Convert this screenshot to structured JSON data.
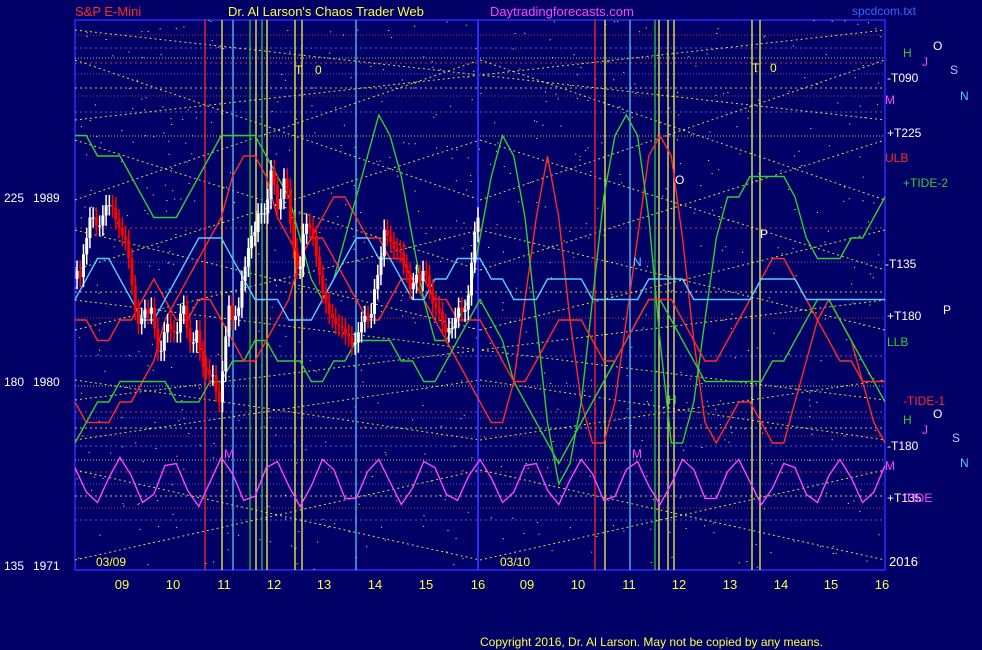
{
  "header": {
    "instrument": "S&P E-Mini",
    "site": "Dr. Al Larson's Chaos Trader Web",
    "url": "Daytradingforecasts.com",
    "file": "spcdcom.txt"
  },
  "footer": {
    "copyright": "Copyright 2016, Dr. Al Larson. May not be copied by any means."
  },
  "colors": {
    "background": "#000066",
    "price_up": "#ffffff",
    "price_down": "#ff0000",
    "cyan": "#55ccff",
    "green": "#33cc33",
    "red": "#ff2a2a",
    "yellow": "#ffff44",
    "magenta": "#ff44ff",
    "grid_blue": "#3333ff"
  },
  "chart_data": {
    "type": "line",
    "title": "S&P E-Mini",
    "x_tick_labels": [
      "09",
      "10",
      "11",
      "12",
      "13",
      "14",
      "15",
      "16",
      "09",
      "10",
      "11",
      "12",
      "13",
      "14",
      "15",
      "16"
    ],
    "date_labels": [
      "03/09",
      "03/10"
    ],
    "year_label": "2016",
    "y_ticks": [
      {
        "angle": "225",
        "price": "1989"
      },
      {
        "angle": "180",
        "price": "1980"
      },
      {
        "angle": "135",
        "price": "1971"
      }
    ],
    "ylim": [
      1971,
      1989
    ],
    "right_labels": [
      {
        "text": "H",
        "color": "#33cc33"
      },
      {
        "text": "J",
        "color": "#ff44ff"
      },
      {
        "text": "O",
        "color": "#ffffff"
      },
      {
        "text": "S",
        "color": "#aaccff"
      },
      {
        "text": "N",
        "color": "#55ccff"
      },
      {
        "text": "-T090",
        "color": "#ffffff"
      },
      {
        "text": "M",
        "color": "#ff44ff"
      },
      {
        "text": "+T225",
        "color": "#ffffff"
      },
      {
        "text": "ULB",
        "color": "#ff2a2a"
      },
      {
        "text": "+TIDE-2",
        "color": "#33cc33"
      },
      {
        "text": "-T135",
        "color": "#ffffff"
      },
      {
        "text": "+T180",
        "color": "#ffffff"
      },
      {
        "text": "P",
        "color": "#ffffff"
      },
      {
        "text": "LLB",
        "color": "#33cc33"
      },
      {
        "text": "-TIDE-1",
        "color": "#ff2a2a"
      },
      {
        "text": "H",
        "color": "#33cc33"
      },
      {
        "text": "J",
        "color": "#ff44ff"
      },
      {
        "text": "O",
        "color": "#ffffff"
      },
      {
        "text": "S",
        "color": "#aaccff"
      },
      {
        "text": "N",
        "color": "#55ccff"
      },
      {
        "text": "-T180",
        "color": "#ffffff"
      },
      {
        "text": "M",
        "color": "#ff44ff"
      },
      {
        "text": "+T135",
        "color": "#ffffff"
      },
      {
        "text": "TIDE",
        "color": "#ff44ff"
      }
    ],
    "plot_letters": [
      {
        "text": "T",
        "color": "#ffff44"
      },
      {
        "text": "0",
        "color": "#ffff44"
      },
      {
        "text": "T",
        "color": "#ffff44"
      },
      {
        "text": "0",
        "color": "#ffff44"
      },
      {
        "text": "O",
        "color": "#ffffff"
      },
      {
        "text": "P",
        "color": "#ffffff"
      },
      {
        "text": "N",
        "color": "#55ccff"
      },
      {
        "text": "M",
        "color": "#ff44ff"
      },
      {
        "text": "M",
        "color": "#ff44ff"
      },
      {
        "text": "H",
        "color": "#33cc33"
      }
    ],
    "series": [
      {
        "label_text": "ULB",
        "color": "#ff2a2a",
        "values": [
          1979,
          1978,
          1978,
          1978,
          1979,
          1979,
          1980,
          1981,
          1983,
          1984,
          1985,
          1986,
          1987,
          1988,
          1990,
          1991,
          1991,
          1990,
          1988,
          1987,
          1986,
          1987,
          1988,
          1989,
          1989,
          1988,
          1987,
          1987,
          1986,
          1986,
          1985,
          1984,
          1983,
          1982,
          1981,
          1980,
          1979,
          1978,
          1978,
          1980,
          1984,
          1988,
          1991,
          1988,
          1983,
          1979,
          1977,
          1977,
          1979,
          1983,
          1987,
          1991,
          1992,
          1991,
          1987,
          1982,
          1978,
          1977,
          1978,
          1979,
          1979,
          1978,
          1977,
          1977,
          1979,
          1981,
          1983,
          1984,
          1983,
          1982,
          1980,
          1978,
          1977
        ]
      },
      {
        "label_text": "+TIDE-2",
        "color": "#33cc33",
        "values": [
          1992,
          1992,
          1991,
          1991,
          1991,
          1990,
          1989,
          1988,
          1988,
          1988,
          1989,
          1990,
          1991,
          1992,
          1992,
          1992,
          1992,
          1991,
          1990,
          1989,
          1987,
          1985,
          1984,
          1985,
          1987,
          1989,
          1991,
          1993,
          1992,
          1990,
          1987,
          1984,
          1982,
          1982,
          1983,
          1984,
          1987,
          1990,
          1992,
          1991,
          1988,
          1983,
          1978,
          1975,
          1976,
          1979,
          1984,
          1989,
          1992,
          1993,
          1992,
          1988,
          1982,
          1977,
          1977,
          1979,
          1983,
          1987,
          1989,
          1989,
          1990,
          1990,
          1990,
          1990,
          1989,
          1987,
          1986,
          1986,
          1986,
          1987,
          1987,
          1988,
          1989
        ]
      },
      {
        "label_text": "LLB",
        "color": "#33cc33",
        "values": [
          1977,
          1978,
          1979,
          1979,
          1980,
          1980,
          1980,
          1980,
          1980,
          1979,
          1979,
          1979,
          1980,
          1980,
          1981,
          1981,
          1982,
          1982,
          1981,
          1981,
          1981,
          1980,
          1980,
          1981,
          1981,
          1982,
          1982,
          1982,
          1982,
          1981,
          1981,
          1980,
          1980,
          1981,
          1982,
          1983,
          1984,
          1983,
          1982,
          1980,
          1979,
          1978,
          1977,
          1976,
          1977,
          1978,
          1979,
          1980,
          1981,
          1982,
          1983,
          1984,
          1984,
          1983,
          1982,
          1981,
          1980,
          1980,
          1980,
          1980,
          1980,
          1980,
          1981,
          1981,
          1982,
          1983,
          1984,
          1984,
          1983,
          1982,
          1981,
          1980,
          1979
        ]
      },
      {
        "label_text": "-TIDE-1",
        "color": "#ff2a2a",
        "values": [
          1983,
          1983,
          1982,
          1982,
          1983,
          1983,
          1984,
          1985,
          1984,
          1983,
          1983,
          1984,
          1984,
          1983,
          1982,
          1981,
          1981,
          1982,
          1983,
          1984,
          1986,
          1987,
          1987,
          1986,
          1985,
          1984,
          1983,
          1983,
          1984,
          1985,
          1985,
          1985,
          1984,
          1984,
          1983,
          1983,
          1983,
          1982,
          1981,
          1980,
          1980,
          1981,
          1982,
          1983,
          1983,
          1983,
          1982,
          1981,
          1981,
          1982,
          1983,
          1984,
          1984,
          1984,
          1983,
          1982,
          1981,
          1981,
          1982,
          1983,
          1984,
          1985,
          1986,
          1986,
          1985,
          1984,
          1983,
          1982,
          1981,
          1981,
          1980,
          1980,
          1980
        ]
      },
      {
        "label_text": "N",
        "color": "#55ccff",
        "values": [
          1984,
          1985,
          1986,
          1986,
          1985,
          1984,
          1983,
          1983,
          1984,
          1985,
          1986,
          1987,
          1987,
          1987,
          1986,
          1985,
          1984,
          1984,
          1984,
          1983,
          1983,
          1983,
          1984,
          1985,
          1986,
          1987,
          1987,
          1986,
          1986,
          1985,
          1984,
          1984,
          1985,
          1985,
          1986,
          1986,
          1986,
          1985,
          1985,
          1984,
          1984,
          1984,
          1985,
          1985,
          1985,
          1985,
          1984,
          1984,
          1984,
          1984,
          1984,
          1985,
          1985,
          1985,
          1985,
          1984,
          1984,
          1984,
          1984,
          1984,
          1984,
          1985,
          1985,
          1985,
          1985,
          1984,
          1984,
          1984,
          1984,
          1984,
          1984,
          1984,
          1984
        ]
      },
      {
        "label_text": "TIDE",
        "color": "#ff44ff",
        "values": [
          1975.8,
          1974.6,
          1974.1,
          1975.3,
          1976.3,
          1975.4,
          1974.1,
          1974.5,
          1975.9,
          1976.0,
          1974.7,
          1973.9,
          1975.1,
          1976.3,
          1975.5,
          1974.2,
          1974.4,
          1975.8,
          1976.1,
          1974.9,
          1973.9,
          1974.9,
          1976.2,
          1975.7,
          1974.3,
          1974.3,
          1975.6,
          1976.2,
          1975.1,
          1974.0,
          1974.8,
          1976.1,
          1975.8,
          1974.5,
          1974.2,
          1975.4,
          1976.2,
          1975.3,
          1974.1,
          1974.6,
          1975.9,
          1976.0,
          1974.7,
          1974.0,
          1975.2,
          1976.2,
          1975.5,
          1974.2,
          1974.4,
          1975.7,
          1976.1,
          1974.9,
          1974.0,
          1975.0,
          1976.2,
          1975.7,
          1974.3,
          1974.3,
          1975.6,
          1976.2,
          1975.1,
          1974.0,
          1974.8,
          1976.0,
          1975.8,
          1974.5,
          1974.1,
          1975.4,
          1976.2,
          1975.3,
          1974.1,
          1974.6,
          1975.9
        ]
      }
    ],
    "price_bars": [
      {
        "open": 1985.0,
        "close": 1985.4
      },
      {
        "open": 1985.4,
        "close": 1985.1
      },
      {
        "open": 1985.1,
        "close": 1986.2
      },
      {
        "open": 1986.2,
        "close": 1987.0
      },
      {
        "open": 1987.0,
        "close": 1988.0
      },
      {
        "open": 1988.0,
        "close": 1988.0
      },
      {
        "open": 1988.0,
        "close": 1987.6
      },
      {
        "open": 1987.6,
        "close": 1987.6
      },
      {
        "open": 1987.6,
        "close": 1988.1
      },
      {
        "open": 1988.1,
        "close": 1988.6
      },
      {
        "open": 1988.6,
        "close": 1988.6
      },
      {
        "open": 1988.6,
        "close": 1988.5
      },
      {
        "open": 1988.5,
        "close": 1987.9
      },
      {
        "open": 1987.9,
        "close": 1987.5
      },
      {
        "open": 1987.5,
        "close": 1987.1
      },
      {
        "open": 1987.1,
        "close": 1986.9
      },
      {
        "open": 1986.9,
        "close": 1986.0
      },
      {
        "open": 1986.0,
        "close": 1984.7
      },
      {
        "open": 1984.7,
        "close": 1983.5
      },
      {
        "open": 1983.5,
        "close": 1982.8
      },
      {
        "open": 1982.8,
        "close": 1983.1
      },
      {
        "open": 1983.1,
        "close": 1983.5
      },
      {
        "open": 1983.5,
        "close": 1983.3
      },
      {
        "open": 1983.3,
        "close": 1983.6
      },
      {
        "open": 1983.6,
        "close": 1982.6
      },
      {
        "open": 1982.6,
        "close": 1981.5
      },
      {
        "open": 1981.5,
        "close": 1981.5
      },
      {
        "open": 1981.5,
        "close": 1982.4
      },
      {
        "open": 1982.4,
        "close": 1982.8
      },
      {
        "open": 1982.8,
        "close": 1982.5
      },
      {
        "open": 1982.5,
        "close": 1982.4
      },
      {
        "open": 1982.4,
        "close": 1982.4
      },
      {
        "open": 1982.4,
        "close": 1983.3
      },
      {
        "open": 1983.3,
        "close": 1983.7
      },
      {
        "open": 1983.7,
        "close": 1982.6
      },
      {
        "open": 1982.6,
        "close": 1981.9
      },
      {
        "open": 1981.9,
        "close": 1981.9
      },
      {
        "open": 1981.9,
        "close": 1982.5
      },
      {
        "open": 1982.5,
        "close": 1981.5
      },
      {
        "open": 1981.5,
        "close": 1980.7
      },
      {
        "open": 1980.7,
        "close": 1980.6
      },
      {
        "open": 1980.6,
        "close": 1980.3
      },
      {
        "open": 1980.3,
        "close": 1980.3
      },
      {
        "open": 1980.3,
        "close": 1979.5
      },
      {
        "open": 1979.5,
        "close": 1979.0
      },
      {
        "open": 1979.0,
        "close": 1980.5
      },
      {
        "open": 1980.5,
        "close": 1982.2
      },
      {
        "open": 1982.2,
        "close": 1983.7
      },
      {
        "open": 1983.7,
        "close": 1983.0
      },
      {
        "open": 1983.0,
        "close": 1983.2
      },
      {
        "open": 1983.2,
        "close": 1983.6
      },
      {
        "open": 1983.6,
        "close": 1984.9
      },
      {
        "open": 1984.9,
        "close": 1985.6
      },
      {
        "open": 1985.6,
        "close": 1986.5
      },
      {
        "open": 1986.5,
        "close": 1987.1
      },
      {
        "open": 1987.1,
        "close": 1987.3
      },
      {
        "open": 1987.3,
        "close": 1988.2
      },
      {
        "open": 1988.2,
        "close": 1988.2
      },
      {
        "open": 1988.2,
        "close": 1988.2
      },
      {
        "open": 1988.2,
        "close": 1988.9
      },
      {
        "open": 1988.9,
        "close": 1990.3
      },
      {
        "open": 1990.3,
        "close": 1989.6
      },
      {
        "open": 1989.6,
        "close": 1988.4
      },
      {
        "open": 1988.4,
        "close": 1988.9
      },
      {
        "open": 1988.9,
        "close": 1989.9
      },
      {
        "open": 1989.9,
        "close": 1989.4
      },
      {
        "open": 1989.4,
        "close": 1987.7
      },
      {
        "open": 1987.7,
        "close": 1986.5
      },
      {
        "open": 1986.5,
        "close": 1985.5
      },
      {
        "open": 1985.5,
        "close": 1985.6
      },
      {
        "open": 1985.6,
        "close": 1987.2
      },
      {
        "open": 1987.2,
        "close": 1987.7
      },
      {
        "open": 1987.7,
        "close": 1987.5
      },
      {
        "open": 1987.5,
        "close": 1987.1
      },
      {
        "open": 1987.1,
        "close": 1986.1
      },
      {
        "open": 1986.1,
        "close": 1985.2
      },
      {
        "open": 1985.2,
        "close": 1984.3
      },
      {
        "open": 1984.3,
        "close": 1983.8
      },
      {
        "open": 1983.8,
        "close": 1983.3
      },
      {
        "open": 1983.3,
        "close": 1983.1
      },
      {
        "open": 1983.1,
        "close": 1982.8
      },
      {
        "open": 1982.8,
        "close": 1982.7
      },
      {
        "open": 1982.7,
        "close": 1982.6
      },
      {
        "open": 1982.6,
        "close": 1982.3
      },
      {
        "open": 1982.3,
        "close": 1982.2
      },
      {
        "open": 1982.2,
        "close": 1981.8
      },
      {
        "open": 1981.8,
        "close": 1981.9
      },
      {
        "open": 1981.9,
        "close": 1982.4
      },
      {
        "open": 1982.4,
        "close": 1982.9
      },
      {
        "open": 1982.9,
        "close": 1983.2
      },
      {
        "open": 1983.2,
        "close": 1983.1
      },
      {
        "open": 1983.1,
        "close": 1983.3
      },
      {
        "open": 1983.3,
        "close": 1984.5
      },
      {
        "open": 1984.5,
        "close": 1985.2
      },
      {
        "open": 1985.2,
        "close": 1986.1
      },
      {
        "open": 1986.1,
        "close": 1987.4
      },
      {
        "open": 1987.4,
        "close": 1987.1
      },
      {
        "open": 1987.1,
        "close": 1986.8
      },
      {
        "open": 1986.8,
        "close": 1986.5
      },
      {
        "open": 1986.5,
        "close": 1986.4
      },
      {
        "open": 1986.4,
        "close": 1986.3
      },
      {
        "open": 1986.3,
        "close": 1985.7
      },
      {
        "open": 1985.7,
        "close": 1985.3
      },
      {
        "open": 1985.3,
        "close": 1984.5
      },
      {
        "open": 1984.5,
        "close": 1984.8
      },
      {
        "open": 1984.8,
        "close": 1985.2
      },
      {
        "open": 1985.2,
        "close": 1984.9
      },
      {
        "open": 1984.9,
        "close": 1985.4
      },
      {
        "open": 1985.4,
        "close": 1985.2
      },
      {
        "open": 1985.2,
        "close": 1984.5
      },
      {
        "open": 1984.5,
        "close": 1983.8
      },
      {
        "open": 1983.8,
        "close": 1983.6
      },
      {
        "open": 1983.6,
        "close": 1983.4
      },
      {
        "open": 1983.4,
        "close": 1982.8
      },
      {
        "open": 1982.8,
        "close": 1982.4
      },
      {
        "open": 1982.4,
        "close": 1982.6
      },
      {
        "open": 1982.6,
        "close": 1982.6
      },
      {
        "open": 1982.6,
        "close": 1983.1
      },
      {
        "open": 1983.1,
        "close": 1983.6
      },
      {
        "open": 1983.6,
        "close": 1983.4
      },
      {
        "open": 1983.4,
        "close": 1983.5
      },
      {
        "open": 1983.5,
        "close": 1984.2
      },
      {
        "open": 1984.2,
        "close": 1985.8
      },
      {
        "open": 1985.8,
        "close": 1987.3
      },
      {
        "open": 1987.3,
        "close": 1988.0
      }
    ],
    "grid": true
  }
}
